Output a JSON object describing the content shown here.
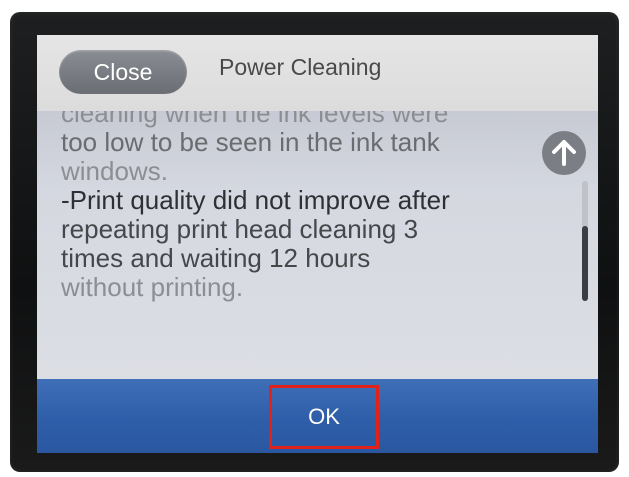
{
  "header": {
    "close_label": "Close",
    "title": "Power Cleaning"
  },
  "content": {
    "lines": [
      "cleaning when the ink levels were",
      "too low to be seen in the ink tank",
      "windows.",
      "-Print quality did not improve after",
      "repeating print head cleaning 3",
      "times and waiting 12 hours",
      "without printing."
    ],
    "scroll_up_icon": "arrow-up-icon"
  },
  "footer": {
    "ok_label": "OK"
  },
  "colors": {
    "accent_blue": "#2f5ea9",
    "close_button_gray": "#7b7e84",
    "highlight_red": "#e0221b"
  }
}
